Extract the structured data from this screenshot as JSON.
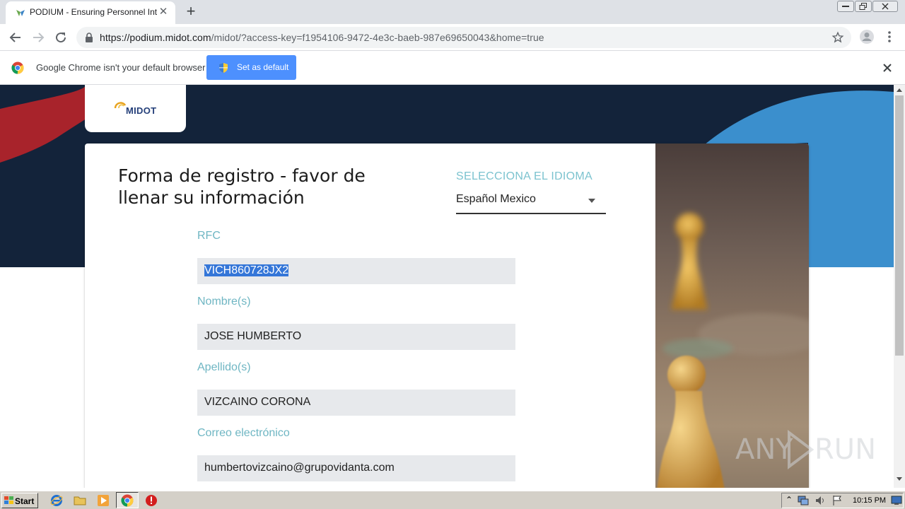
{
  "browser": {
    "tab_title": "PODIUM - Ensuring Personnel Integrity",
    "url_host": "https://podium.midot.com",
    "url_path": "/midot/?access-key=f1954106-9472-4e3c-baeb-987e69650043&home=true"
  },
  "infobar": {
    "message": "Google Chrome isn't your default browser",
    "button_label": "Set as default"
  },
  "page": {
    "logo_text": "MIDOT",
    "title": "Forma de registro - favor de llenar su información",
    "language": {
      "label": "SELECCIONA EL IDIOMA",
      "value": "Español Mexico"
    },
    "fields": [
      {
        "label": "RFC",
        "value": "VICH860728JX2",
        "selected": true
      },
      {
        "label": "Nombre(s)",
        "value": "JOSE HUMBERTO"
      },
      {
        "label": "Apellido(s)",
        "value": "VIZCAINO CORONA"
      },
      {
        "label": "Correo electrónico",
        "value": "humbertovizcaino@grupovidanta.com"
      }
    ]
  },
  "watermark": {
    "text_left": "ANY",
    "text_right": "RUN"
  },
  "taskbar": {
    "start_label": "Start",
    "clock": "10:15 PM"
  },
  "colors": {
    "hero_dark": "#13233a",
    "accent_red": "#a8232b",
    "accent_blue": "#3b8fcd",
    "label_teal": "#6fb6c3",
    "infobar_button": "#4d90fe"
  }
}
